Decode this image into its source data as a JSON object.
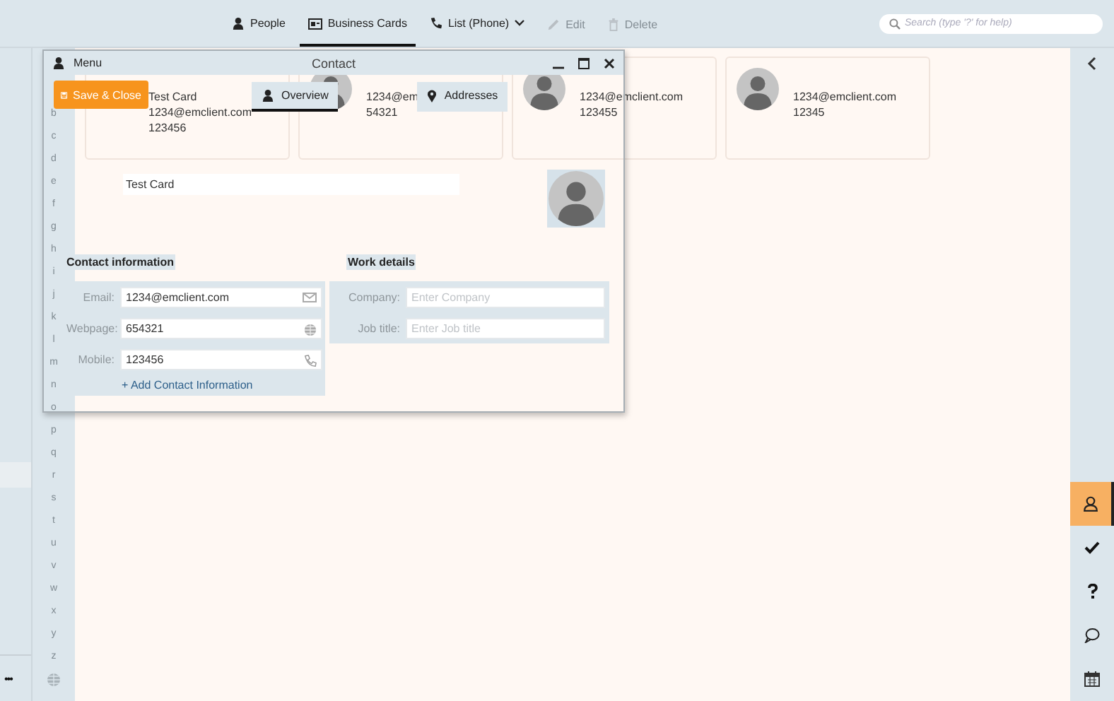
{
  "toolbar": {
    "views": [
      {
        "label": "People",
        "selected": false,
        "dropdown": false
      },
      {
        "label": "Business Cards",
        "selected": true,
        "dropdown": false
      },
      {
        "label": "List (Phone)",
        "selected": false,
        "dropdown": true
      }
    ],
    "actions": [
      {
        "label": "Edit",
        "disabled": true
      },
      {
        "label": "Delete",
        "disabled": true
      }
    ]
  },
  "search": {
    "placeholder": "Search (type '?' for help)"
  },
  "left_pane": {
    "more": "•••"
  },
  "alphabet": [
    "b",
    "c",
    "d",
    "e",
    "f",
    "g",
    "h",
    "i",
    "j",
    "k",
    "l",
    "m",
    "n",
    "o",
    "p",
    "q",
    "r",
    "s",
    "t",
    "u",
    "v",
    "w",
    "x",
    "y",
    "z"
  ],
  "cards": [
    {
      "avatar": false,
      "lines": [
        "Test Card",
        "1234@emclient.com",
        "123456"
      ]
    },
    {
      "avatar": true,
      "lines": [
        "1234@em",
        "54321"
      ]
    },
    {
      "avatar": true,
      "lines": [
        "1234@emclient.com",
        "123455"
      ]
    },
    {
      "avatar": true,
      "lines": [
        "1234@emclient.com",
        "12345"
      ]
    }
  ],
  "dialog": {
    "menu": "Menu",
    "title": "Contact",
    "save_button": "Save & Close",
    "tabs": [
      {
        "label": "Overview",
        "selected": true
      },
      {
        "label": "Addresses",
        "selected": false
      }
    ],
    "name_value": "Test Card",
    "sections": [
      {
        "title": "Contact information",
        "fields": [
          {
            "label": "Email:",
            "value": "1234@emclient.com"
          },
          {
            "label": "Webpage:",
            "value": "654321"
          },
          {
            "label": "Mobile:",
            "value": "123456"
          }
        ],
        "add_link": "+ Add Contact Information"
      },
      {
        "title": "Work details",
        "fields": [
          {
            "label": "Company:",
            "placeholder": "Enter Company"
          },
          {
            "label": "Job title:",
            "placeholder": "Enter Job title"
          }
        ]
      }
    ]
  },
  "right_rail": [
    {
      "selected": true
    },
    {
      "selected": false
    },
    {
      "selected": false
    },
    {
      "selected": false
    },
    {
      "selected": false
    }
  ]
}
